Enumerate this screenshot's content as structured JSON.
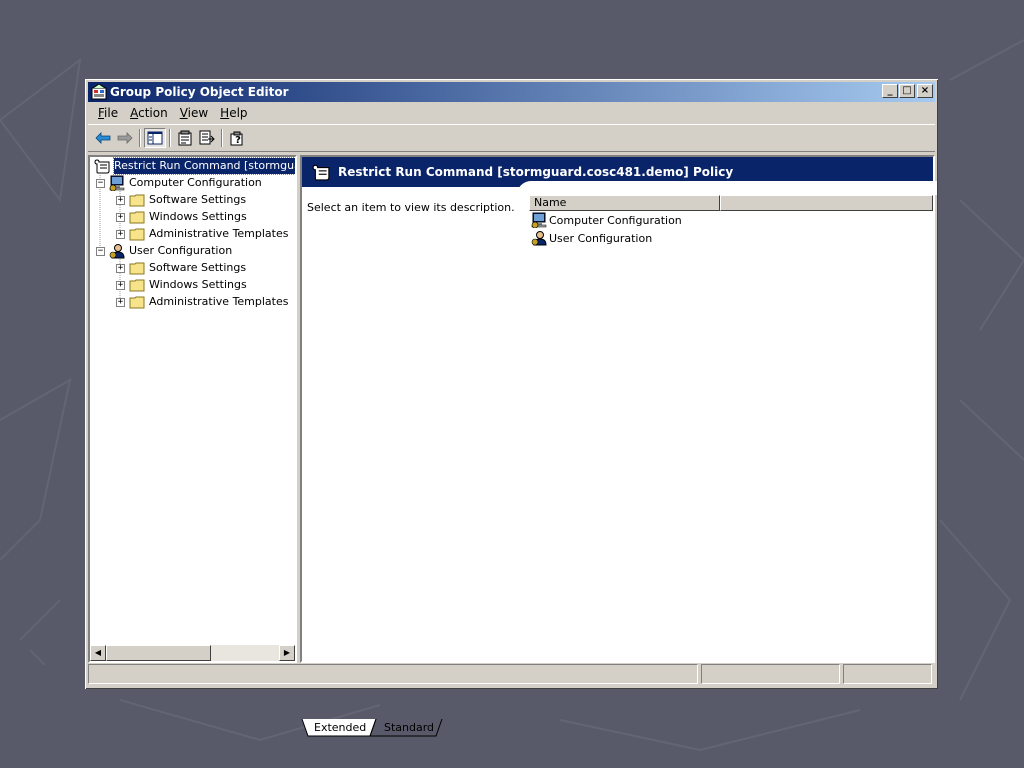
{
  "window": {
    "title": "Group Policy Object Editor",
    "controls": {
      "minimize": "_",
      "maximize": "□",
      "close": "×"
    }
  },
  "menu": {
    "file": {
      "key": "F",
      "rest": "ile"
    },
    "action": {
      "key": "A",
      "rest": "ction"
    },
    "view": {
      "key": "V",
      "rest": "iew"
    },
    "help": {
      "key": "H",
      "rest": "elp"
    }
  },
  "toolbar": {
    "icons": [
      "back-arrow-icon",
      "forward-arrow-icon",
      "show-hide-tree-icon",
      "properties-icon",
      "export-list-icon",
      "help-icon"
    ]
  },
  "tree": {
    "root": "Restrict Run Command [stormguar­",
    "computer": "Computer Configuration",
    "computer_children": [
      "Software Settings",
      "Windows Settings",
      "Administrative Templates"
    ],
    "user": "User Configuration",
    "user_children": [
      "Software Settings",
      "Windows Settings",
      "Administrative Templates"
    ],
    "expander_plus": "+",
    "expander_minus": "−"
  },
  "right": {
    "banner_title": "Restrict Run Command [stormguard.cosc481.demo] Policy",
    "description": "Select an item to view its description.",
    "column_name": "Name",
    "rows": [
      "Computer Configuration",
      "User Configuration"
    ]
  },
  "tabs": {
    "extended": "Extended",
    "standard": "Standard"
  },
  "colors": {
    "background": "#585a6a",
    "title_gradient_start": "#0a246a",
    "title_gradient_end": "#a6caf0",
    "window_face": "#d4d0c8",
    "banner": "#0a246a",
    "folder": "#f7e38a"
  }
}
